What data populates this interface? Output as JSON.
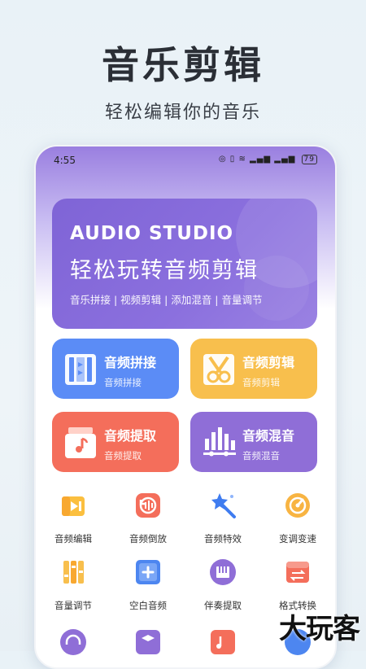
{
  "promo": {
    "title": "音乐剪辑",
    "subtitle": "轻松编辑你的音乐"
  },
  "status": {
    "time": "4:55",
    "battery": "79"
  },
  "banner": {
    "title_en": "AUDIO STUDIO",
    "title_cn": "轻松玩转音频剪辑",
    "tags": "音乐拼接 | 视频剪辑 | 添加混音 | 音量调节"
  },
  "cards": [
    {
      "title": "音频拼接",
      "subtitle": "音频拼接",
      "color": "#5b8cf6",
      "icon": "audio-splice-icon"
    },
    {
      "title": "音频剪辑",
      "subtitle": "音频剪辑",
      "color": "#f8bf4d",
      "icon": "scissors-icon"
    },
    {
      "title": "音频提取",
      "subtitle": "音频提取",
      "color": "#f46e5b",
      "icon": "music-extract-icon"
    },
    {
      "title": "音频混音",
      "subtitle": "音频混音",
      "color": "#8f6ed7",
      "icon": "mixer-icon"
    }
  ],
  "tools": [
    {
      "label": "音频编辑",
      "icon": "audio-edit-icon"
    },
    {
      "label": "音频倒放",
      "icon": "reverse-icon"
    },
    {
      "label": "音频特效",
      "icon": "magic-wand-icon"
    },
    {
      "label": "变调变速",
      "icon": "pitch-speed-icon"
    },
    {
      "label": "音量调节",
      "icon": "volume-adjust-icon"
    },
    {
      "label": "空白音频",
      "icon": "blank-audio-icon"
    },
    {
      "label": "伴奏提取",
      "icon": "piano-icon"
    },
    {
      "label": "格式转换",
      "icon": "format-convert-icon"
    }
  ],
  "watermark": "大玩客"
}
